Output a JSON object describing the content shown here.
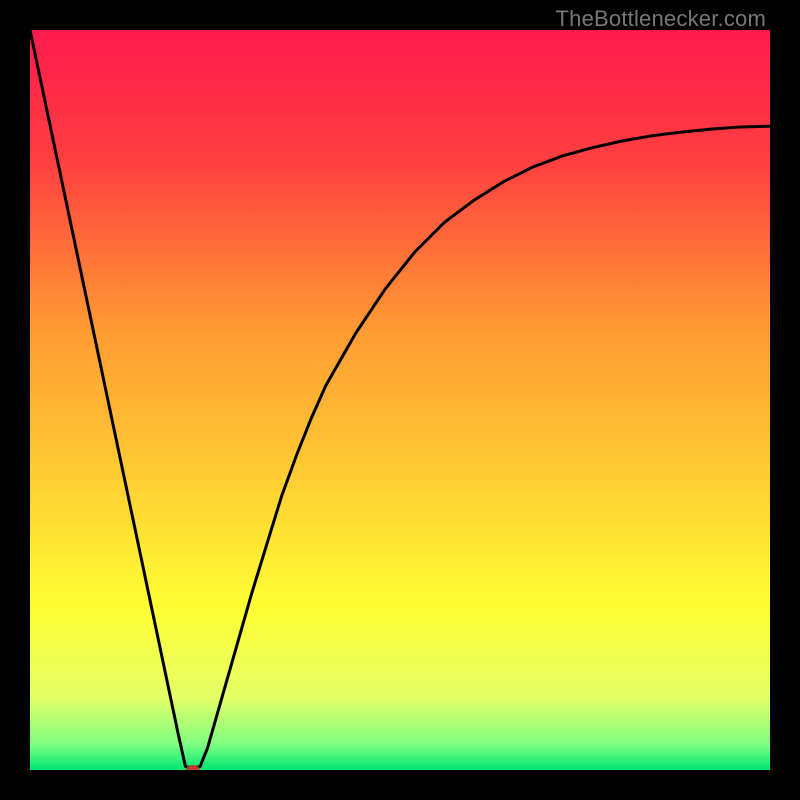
{
  "watermark": "TheBottlenecker.com",
  "chart_data": {
    "type": "line",
    "title": "",
    "xlabel": "",
    "ylabel": "",
    "xlim": [
      0,
      100
    ],
    "ylim": [
      0,
      100
    ],
    "grid": false,
    "legend": false,
    "background_gradient": {
      "stops": [
        {
          "offset": 0.0,
          "color": "#ff1a4d"
        },
        {
          "offset": 0.18,
          "color": "#ff4040"
        },
        {
          "offset": 0.4,
          "color": "#ff9933"
        },
        {
          "offset": 0.6,
          "color": "#ffcc33"
        },
        {
          "offset": 0.78,
          "color": "#ffff33"
        },
        {
          "offset": 0.9,
          "color": "#e6ff66"
        },
        {
          "offset": 0.965,
          "color": "#80ff80"
        },
        {
          "offset": 1.0,
          "color": "#00e673"
        }
      ]
    },
    "series": [
      {
        "name": "bottleneck-curve",
        "stroke": "#000000",
        "stroke_width": 3,
        "x": [
          0,
          2,
          4,
          6,
          8,
          10,
          12,
          14,
          16,
          18,
          20,
          21,
          22,
          23,
          24,
          26,
          28,
          30,
          32,
          34,
          36,
          38,
          40,
          44,
          48,
          52,
          56,
          60,
          64,
          68,
          72,
          76,
          80,
          84,
          88,
          92,
          96,
          100
        ],
        "values": [
          100,
          90.5,
          81,
          71.5,
          62,
          52.5,
          43,
          33.5,
          24,
          14.5,
          5,
          0.5,
          0.2,
          0.5,
          3,
          10,
          17,
          24,
          30.5,
          37,
          42.5,
          47.5,
          52,
          59,
          65,
          70,
          74,
          77,
          79.5,
          81.5,
          83,
          84.1,
          85,
          85.7,
          86.2,
          86.6,
          86.9,
          87
        ]
      }
    ],
    "marker": {
      "x": 22,
      "y": 0,
      "rx": 7,
      "ry": 5,
      "color": "#c0392b"
    }
  }
}
